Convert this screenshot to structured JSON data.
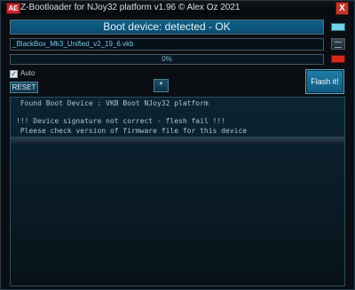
{
  "window": {
    "title": "Z-Bootloader for NJoy32 platform v1.96 © Alex Oz 2021",
    "icon_label": "AE",
    "close_symbol": "X"
  },
  "status": {
    "text": "Boot device: detected - OK",
    "indicator_color": "#6ed3ea"
  },
  "file": {
    "path": "_BlackBox_Mk3_Unified_v2_19_6.vkb"
  },
  "progress": {
    "percent": 0,
    "label": "0%",
    "indicator_color": "#d4281e"
  },
  "options": {
    "auto_checked": true,
    "auto_check_mark": "✓",
    "auto_label": "Auto"
  },
  "buttons": {
    "reset": "RESET",
    "star": "*",
    "flash": "Flash it!"
  },
  "log": {
    "lines": [
      " Found Boot Device : VKB Boot NJoy32 platform",
      "!!! Device signature not correct - flesh fail !!!",
      " Pleese check version of firmware file for this device"
    ]
  }
}
